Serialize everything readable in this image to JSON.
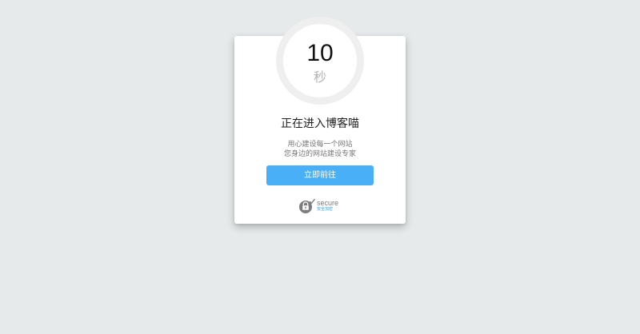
{
  "countdown": {
    "number": "10",
    "unit": "秒"
  },
  "title": "正在进入博客喵",
  "description": {
    "line1": "用心建设每一个网站",
    "line2": "您身边的网站建设专家"
  },
  "button": {
    "label": "立即前往"
  },
  "secure": {
    "label": "secure",
    "sublabel": "安全加密",
    "icon": "padlock-check-icon"
  },
  "colors": {
    "background": "#e6eaeb",
    "card": "#ffffff",
    "accent": "#49aff7",
    "ring": "#efeff0"
  }
}
